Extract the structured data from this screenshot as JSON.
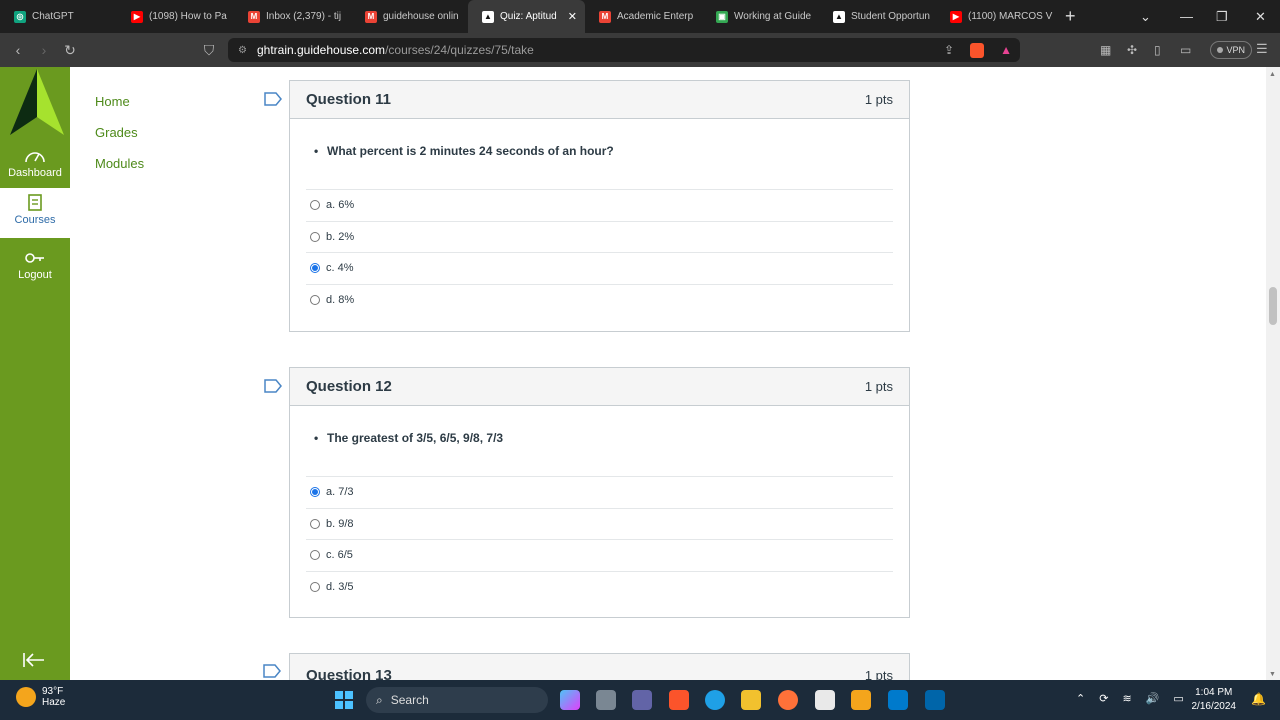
{
  "browser": {
    "tabs": [
      {
        "label": "ChatGPT",
        "favicon_color": "#10a37f",
        "favicon_glyph": "◎"
      },
      {
        "label": "(1098) How to Pa",
        "favicon_color": "#ff0000",
        "favicon_glyph": "▶"
      },
      {
        "label": "Inbox (2,379) - tij",
        "favicon_color": "#ea4335",
        "favicon_glyph": "M"
      },
      {
        "label": "guidehouse onlin",
        "favicon_color": "#ea4335",
        "favicon_glyph": "M"
      },
      {
        "label": "Quiz: Aptitud",
        "favicon_color": "#ffffff",
        "favicon_glyph": "▲",
        "active": true
      },
      {
        "label": "Academic Enterp",
        "favicon_color": "#ea4335",
        "favicon_glyph": "M"
      },
      {
        "label": "Working at Guide",
        "favicon_color": "#34a853",
        "favicon_glyph": "▣"
      },
      {
        "label": "Student Opportun",
        "favicon_color": "#ffffff",
        "favicon_glyph": "▲"
      },
      {
        "label": "(1100) MARCOS V",
        "favicon_color": "#ff0000",
        "favicon_glyph": "▶"
      }
    ],
    "new_tab_label": "+",
    "close_tab_glyph": "✕",
    "url_host": "ghtrain.guidehouse.com",
    "url_path": "/courses/24/quizzes/75/take",
    "vpn_label": "VPN"
  },
  "global_nav": {
    "items": [
      {
        "label": "Dashboard",
        "icon": "dashboard-icon"
      },
      {
        "label": "Courses",
        "icon": "courses-icon",
        "active": true
      },
      {
        "label": "Logout",
        "icon": "logout-icon"
      }
    ],
    "brand_color": "#6a9a1f"
  },
  "course_nav": {
    "items": [
      "Home",
      "Grades",
      "Modules"
    ]
  },
  "questions": [
    {
      "title": "Question 11",
      "points": "1 pts",
      "text": "What percent is 2 minutes 24 seconds of an hour?",
      "answers": [
        {
          "label": "a. 6%",
          "selected": false
        },
        {
          "label": "b. 2%",
          "selected": false
        },
        {
          "label": "c. 4%",
          "selected": true
        },
        {
          "label": "d. 8%",
          "selected": false
        }
      ]
    },
    {
      "title": "Question 12",
      "points": "1 pts",
      "text": "The greatest of 3/5, 6/5, 9/8, 7/3",
      "answers": [
        {
          "label": "a. 7/3",
          "selected": true
        },
        {
          "label": "b. 9/8",
          "selected": false
        },
        {
          "label": "c. 6/5",
          "selected": false
        },
        {
          "label": "d. 3/5",
          "selected": false
        }
      ]
    },
    {
      "title": "Question 13",
      "points": "1 pts"
    }
  ],
  "taskbar": {
    "weather_temp": "93°F",
    "weather_desc": "Haze",
    "search_label": "Search",
    "time": "1:04 PM",
    "date": "2/16/2024"
  }
}
